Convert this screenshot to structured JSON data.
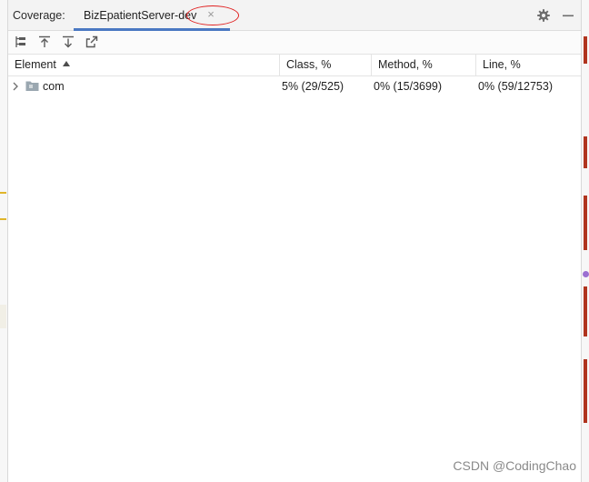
{
  "tool_window": {
    "title": "Coverage:",
    "tab": {
      "label": "BizEpatientServer-dev",
      "close_glyph": "×"
    },
    "actions": [
      {
        "name": "settings-gear-icon"
      },
      {
        "name": "hide-minimize-icon"
      }
    ]
  },
  "toolbar": {
    "buttons": [
      {
        "name": "flatten-packages-icon"
      },
      {
        "name": "navigate-up-icon"
      },
      {
        "name": "navigate-down-icon"
      },
      {
        "name": "export-report-icon"
      }
    ]
  },
  "table": {
    "columns": [
      {
        "label": "Element",
        "sorted": "ascending"
      },
      {
        "label": "Class, %"
      },
      {
        "label": "Method, %"
      },
      {
        "label": "Line, %"
      }
    ],
    "rows": [
      {
        "element": "com",
        "icon": "package-folder-icon",
        "expanded": false,
        "class_cov": "5% (29/525)",
        "method_cov": "0% (15/3699)",
        "line_cov": "0% (59/12753)"
      }
    ]
  },
  "watermark": "CSDN @CodingChao",
  "colors": {
    "tab_underline": "#4a78c2",
    "annotation": "#e02020",
    "folder": "#9aa7b0"
  }
}
